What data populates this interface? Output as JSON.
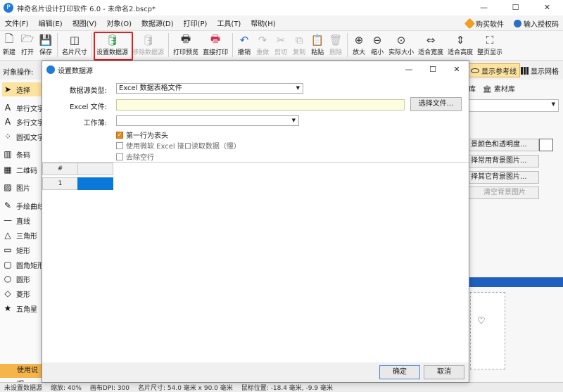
{
  "app": {
    "title": "神奇名片设计打印软件 6.0 - 未命名2.bscp*",
    "icon_glyph": "P",
    "window_buttons": {
      "min": "—",
      "max": "☐",
      "close": "✕"
    }
  },
  "menu": {
    "items": [
      "文件(F)",
      "编辑(E)",
      "视图(V)",
      "对象(O)",
      "数据源(D)",
      "打印(P)",
      "工具(T)",
      "帮助(H)"
    ],
    "buy": "购买软件",
    "license": "输入授权码"
  },
  "toolbar": {
    "items": [
      {
        "label": "新建",
        "icon": "new-file-icon",
        "glyph": "🗋"
      },
      {
        "label": "打开",
        "icon": "open-icon",
        "glyph": "🗁"
      },
      {
        "label": "保存",
        "icon": "save-icon",
        "glyph": "💾"
      },
      {
        "label": "名片尺寸",
        "icon": "card-size-icon",
        "glyph": "◫"
      },
      {
        "label": "设置数据源",
        "icon": "database-icon",
        "glyph": "🛢"
      },
      {
        "label": "移除数据源",
        "icon": "remove-database-icon",
        "glyph": "🛢"
      },
      {
        "label": "打印预览",
        "icon": "print-preview-icon",
        "glyph": "🖶"
      },
      {
        "label": "直接打印",
        "icon": "print-icon",
        "glyph": "🖶"
      },
      {
        "label": "撤销",
        "icon": "undo-icon",
        "glyph": "↶"
      },
      {
        "label": "重做",
        "icon": "redo-icon",
        "glyph": "↷"
      },
      {
        "label": "剪切",
        "icon": "cut-icon",
        "glyph": "✂"
      },
      {
        "label": "复制",
        "icon": "copy-icon",
        "glyph": "⧉"
      },
      {
        "label": "粘贴",
        "icon": "paste-icon",
        "glyph": "📋"
      },
      {
        "label": "删除",
        "icon": "delete-icon",
        "glyph": "🗑"
      },
      {
        "label": "放大",
        "icon": "zoom-in-icon",
        "glyph": "⊕"
      },
      {
        "label": "缩小",
        "icon": "zoom-out-icon",
        "glyph": "⊖"
      },
      {
        "label": "实际大小",
        "icon": "actual-size-icon",
        "glyph": "⊙"
      },
      {
        "label": "适合宽度",
        "icon": "fit-width-icon",
        "glyph": "⇔"
      },
      {
        "label": "适合高度",
        "icon": "fit-height-icon",
        "glyph": "⇕"
      },
      {
        "label": "整页显示",
        "icon": "full-page-icon",
        "glyph": "⛶"
      }
    ]
  },
  "ops": {
    "label": "对象操作:",
    "show_ref_lines": "显示参考线",
    "show_grid": "显示网格"
  },
  "left_panel": {
    "items": [
      {
        "label": "选择",
        "glyph": "➤",
        "icon": "pointer-icon"
      },
      {
        "label": "单行文字",
        "glyph": "A",
        "icon": "single-line-text-icon"
      },
      {
        "label": "多行文字",
        "glyph": "A",
        "icon": "multi-line-text-icon"
      },
      {
        "label": "圆弧文字",
        "glyph": "⁘",
        "icon": "arc-text-icon"
      },
      {
        "label": "条码",
        "glyph": "▥",
        "icon": "barcode-icon"
      },
      {
        "label": "二维码",
        "glyph": "▦",
        "icon": "qrcode-icon"
      },
      {
        "label": "图片",
        "glyph": "▨",
        "icon": "image-icon"
      },
      {
        "label": "手绘曲线",
        "glyph": "✎",
        "icon": "freehand-icon"
      },
      {
        "label": "直线",
        "glyph": "—",
        "icon": "line-icon"
      },
      {
        "label": "三角形",
        "glyph": "△",
        "icon": "triangle-icon"
      },
      {
        "label": "矩形",
        "glyph": "▭",
        "icon": "rectangle-icon"
      },
      {
        "label": "圆角矩形",
        "glyph": "▢",
        "icon": "rounded-rectangle-icon"
      },
      {
        "label": "圆形",
        "glyph": "○",
        "icon": "circle-icon"
      },
      {
        "label": "菱形",
        "glyph": "◇",
        "icon": "diamond-icon"
      },
      {
        "label": "五角星",
        "glyph": "★",
        "icon": "star-icon"
      }
    ],
    "bottom": "使用说明"
  },
  "right_panel": {
    "tab_library": "库",
    "tab_material": "素材库",
    "btn_bg_color": "景颜色和透明度...",
    "btn_common_bg": "择常用背景图片...",
    "btn_other_bg": "择其它背景图片...",
    "btn_clear_bg": "清空背景图片"
  },
  "status": {
    "no_source": "未设置数据源",
    "zoom": "缩放: 40%",
    "dpi": "画布DPI: 300",
    "card_size": "名片尺寸: 54.0 毫米 x 90.0 毫米",
    "mouse": "鼠标位置: -18.4 毫米, -9.9 毫米"
  },
  "dialog": {
    "title": "设置数据源",
    "source_type_label": "数据源类型:",
    "source_type_value": "Excel 数据表格文件",
    "excel_file_label": "Excel 文件:",
    "excel_file_value": "",
    "select_file": "选择文件...",
    "sheet_label": "工作薄:",
    "sheet_value": "",
    "first_row_header": "第一行为表头",
    "first_row_header_checked": true,
    "use_ms_excel": "使用微软 Excel 接口读取数据（慢）",
    "use_ms_excel_checked": false,
    "remove_empty": "去除空行",
    "remove_empty_checked": false,
    "grid_header": "#",
    "grid_row": "1",
    "ok": "确定",
    "cancel": "取消"
  }
}
